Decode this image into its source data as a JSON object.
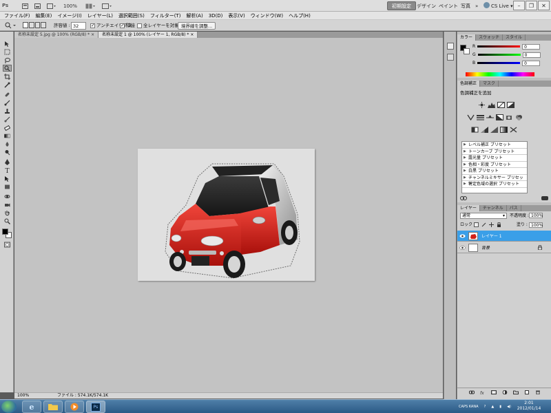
{
  "appbar": {
    "logo": "Ps",
    "zoom": "100%",
    "workspaces": [
      "初期設定",
      "デザイン",
      "ペイント",
      "写真"
    ],
    "more": "»",
    "cslive": "CS Live"
  },
  "menu": [
    "ファイル(F)",
    "編集(E)",
    "イメージ(I)",
    "レイヤー(L)",
    "選択範囲(S)",
    "フィルター(T)",
    "解析(A)",
    "3D(D)",
    "表示(V)",
    "ウィンドウ(W)",
    "ヘルプ(H)"
  ],
  "options": {
    "tolerance_label": "許容値 :",
    "tolerance_value": "32",
    "antialias": "アンチエイリアス",
    "contiguous": "隣接",
    "all_layers": "全レイヤーを対象",
    "refine_edge": "境界線を調整..."
  },
  "tabs": [
    {
      "label": "名称未設定 5.jpg @ 100% (RGB/8) *"
    },
    {
      "label": "名称未設定 1 @ 100% (レイヤー 1, RGB/8) *"
    }
  ],
  "status": {
    "zoom": "100%",
    "file": "ファイル : 574.1K/574.1K"
  },
  "color_panel": {
    "tabs": [
      "カラー",
      "スウォッチ",
      "スタイル"
    ],
    "channels": [
      {
        "label": "R",
        "value": "0"
      },
      {
        "label": "G",
        "value": "0"
      },
      {
        "label": "B",
        "value": "0"
      }
    ]
  },
  "adjust_panel": {
    "tabs": [
      "色調補正",
      "マスク"
    ],
    "heading": "色調補正を追加",
    "presets": [
      "レベル補正 プリセット",
      "トーンカーブ プリセット",
      "露光量 プリセット",
      "色相・彩度 プリセット",
      "白黒 プリセット",
      "チャンネルミキサー プリセット",
      "特定色域の選択 プリセット"
    ]
  },
  "layers_panel": {
    "tabs": [
      "レイヤー",
      "チャンネル",
      "パス"
    ],
    "blend_mode": "通常",
    "opacity_label": "不透明度 :",
    "opacity_value": "100%",
    "lock_label": "ロック :",
    "fill_label": "塗り :",
    "fill_value": "100%",
    "layers": [
      {
        "name": "レイヤー 1",
        "selected": true
      },
      {
        "name": "背景",
        "selected": false
      }
    ]
  },
  "taskbar": {
    "lang": "CAPS KANA",
    "time": "2:01",
    "date": "2012/01/14"
  },
  "colors": {
    "accent_selected": "#3a9fe8",
    "car_red": "#d42016"
  }
}
